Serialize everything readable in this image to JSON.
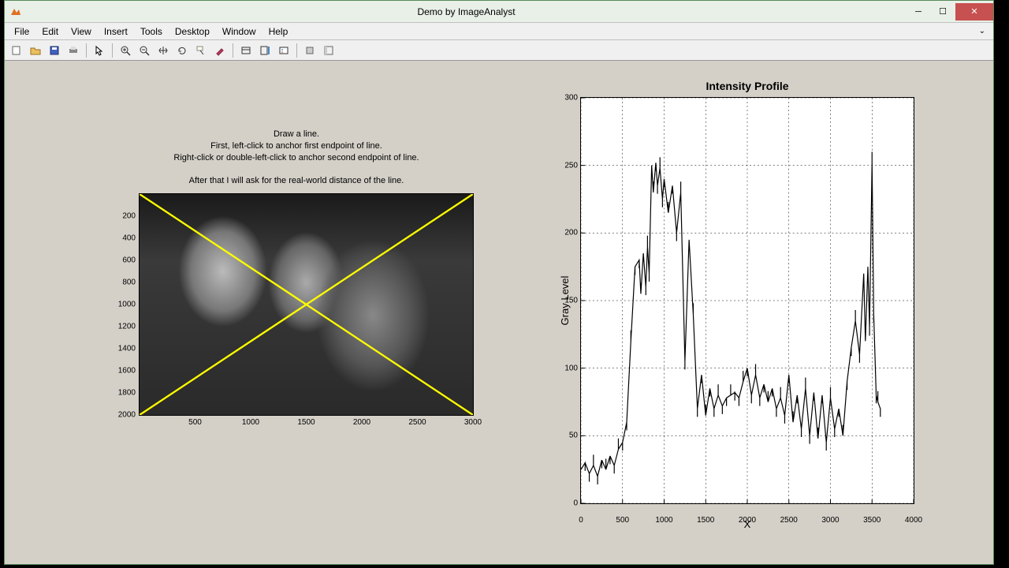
{
  "window": {
    "title": "Demo by ImageAnalyst"
  },
  "menu": {
    "file": "File",
    "edit": "Edit",
    "view": "View",
    "insert": "Insert",
    "tools": "Tools",
    "desktop": "Desktop",
    "window": "Window",
    "help": "Help"
  },
  "instructions": {
    "l1": "Draw a line.",
    "l2": "First, left-click to anchor first endpoint of line.",
    "l3": "Right-click or double-left-click to anchor second endpoint of line.",
    "l4": "After that I will ask for the real-world distance of the line."
  },
  "left_axes": {
    "xticks": [
      "500",
      "1000",
      "1500",
      "2000",
      "2500",
      "3000"
    ],
    "yticks": [
      "200",
      "400",
      "600",
      "800",
      "1000",
      "1200",
      "1400",
      "1600",
      "1800",
      "2000"
    ],
    "xmax": 3000,
    "ymax": 2000
  },
  "chart_data": {
    "type": "line",
    "title": "Intensity Profile",
    "xlabel": "X",
    "ylabel": "Gray Level",
    "xlim": [
      0,
      4000
    ],
    "ylim": [
      0,
      300
    ],
    "xticks": [
      0,
      500,
      1000,
      1500,
      2000,
      2500,
      3000,
      3500,
      4000
    ],
    "yticks": [
      0,
      50,
      100,
      150,
      200,
      250,
      300
    ],
    "x": [
      0,
      50,
      100,
      150,
      200,
      250,
      300,
      350,
      400,
      450,
      500,
      550,
      600,
      650,
      700,
      720,
      750,
      780,
      800,
      820,
      850,
      870,
      900,
      920,
      950,
      980,
      1000,
      1050,
      1100,
      1150,
      1200,
      1250,
      1300,
      1350,
      1400,
      1450,
      1500,
      1550,
      1600,
      1650,
      1700,
      1750,
      1800,
      1850,
      1900,
      1950,
      2000,
      2050,
      2100,
      2150,
      2200,
      2250,
      2300,
      2350,
      2400,
      2450,
      2500,
      2550,
      2600,
      2650,
      2700,
      2750,
      2800,
      2850,
      2900,
      2950,
      3000,
      3050,
      3100,
      3150,
      3200,
      3250,
      3300,
      3350,
      3400,
      3420,
      3450,
      3470,
      3500,
      3520,
      3550,
      3570,
      3600
    ],
    "values": [
      25,
      30,
      22,
      28,
      20,
      32,
      25,
      35,
      28,
      40,
      45,
      60,
      120,
      175,
      180,
      155,
      185,
      160,
      190,
      170,
      250,
      230,
      252,
      235,
      248,
      225,
      240,
      215,
      235,
      200,
      230,
      105,
      195,
      140,
      70,
      95,
      65,
      85,
      70,
      80,
      72,
      78,
      80,
      82,
      78,
      90,
      100,
      80,
      95,
      78,
      88,
      75,
      85,
      70,
      78,
      65,
      95,
      60,
      80,
      55,
      85,
      50,
      82,
      48,
      80,
      45,
      78,
      55,
      70,
      50,
      90,
      115,
      135,
      110,
      170,
      120,
      175,
      130,
      252,
      140,
      80,
      75,
      70
    ]
  }
}
